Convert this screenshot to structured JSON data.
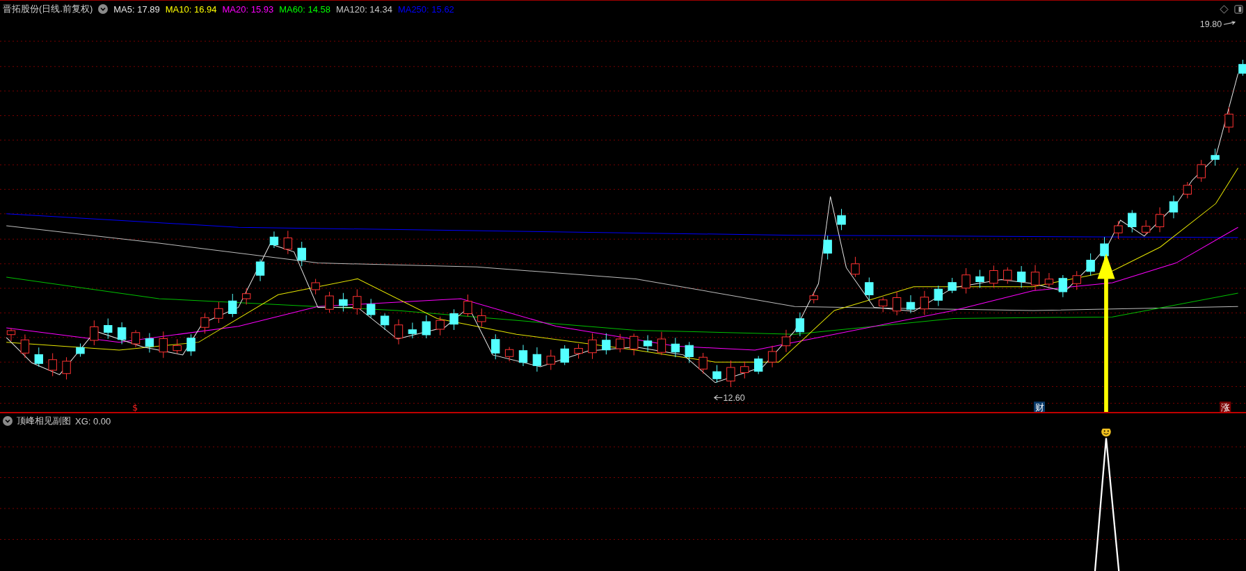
{
  "chart_title": "晋拓股份(日线.前复权)",
  "ma_legend": [
    {
      "label": "MA5:",
      "value": "17.89",
      "color": "#e6e6e6"
    },
    {
      "label": "MA10:",
      "value": "16.94",
      "color": "#ffff00"
    },
    {
      "label": "MA20:",
      "value": "15.93",
      "color": "#ff00ff"
    },
    {
      "label": "MA60:",
      "value": "14.58",
      "color": "#00ff00"
    },
    {
      "label": "MA120:",
      "value": "14.34",
      "color": "#c8c8c8"
    },
    {
      "label": "MA250:",
      "value": "15.62",
      "color": "#0000ff"
    }
  ],
  "price_labels": {
    "high": "19.80",
    "low": "12.60"
  },
  "markers": [
    {
      "kind": "dollar",
      "text": "$"
    },
    {
      "kind": "finance",
      "text": "财"
    },
    {
      "kind": "rise",
      "text": "涨"
    }
  ],
  "sub_chart": {
    "title": "顶峰相见副图",
    "reading": "XG: 0.00"
  }
}
